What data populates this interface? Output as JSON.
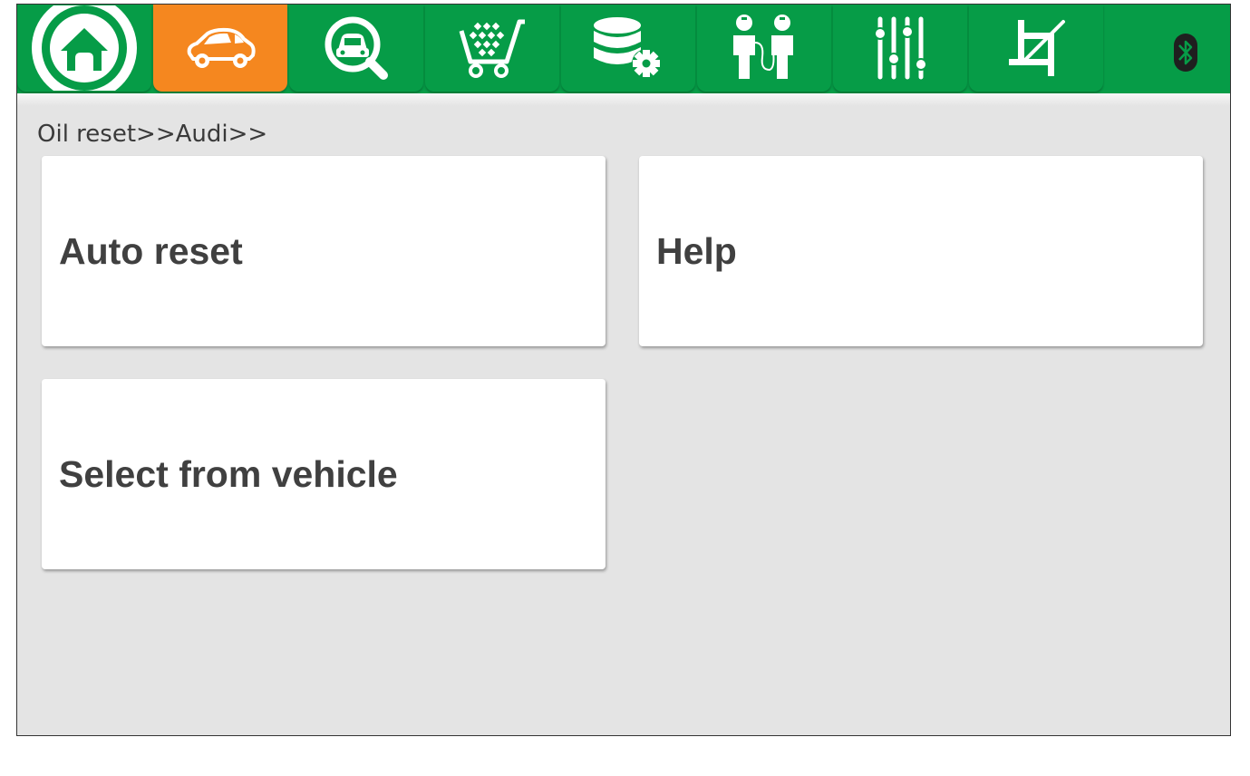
{
  "toolbar": {
    "tabs": [
      {
        "name": "home-icon",
        "active": false
      },
      {
        "name": "car-icon",
        "active": true
      },
      {
        "name": "vehicle-search-icon",
        "active": false
      },
      {
        "name": "shopping-cart-icon",
        "active": false
      },
      {
        "name": "database-settings-icon",
        "active": false
      },
      {
        "name": "people-icon",
        "active": false
      },
      {
        "name": "sliders-icon",
        "active": false
      },
      {
        "name": "crop-icon",
        "active": false
      }
    ],
    "status_icon": "bluetooth-icon"
  },
  "colors": {
    "toolbar_green": "#069c47",
    "active_orange": "#f5871f",
    "background_gray": "#e4e4e4",
    "card_text": "#404040"
  },
  "breadcrumb": "Oil reset>>Audi>>",
  "menu": {
    "auto_reset": "Auto reset",
    "help": "Help",
    "select_from_vehicle": "Select from vehicle"
  }
}
